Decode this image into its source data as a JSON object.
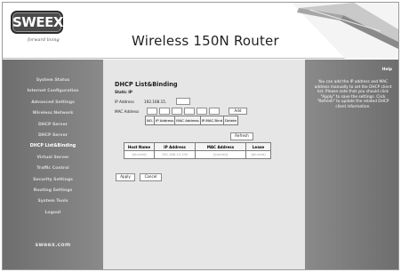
{
  "brand": {
    "logo_text": "SWEEX",
    "tagline": "forward living"
  },
  "header": {
    "title": "Wireless 150N Router"
  },
  "sidebar": {
    "items": [
      {
        "label": "System Status"
      },
      {
        "label": "Internet Configuration"
      },
      {
        "label": "Advanced Settings"
      },
      {
        "label": "Wireless Network"
      },
      {
        "label": "DHCP Server"
      },
      {
        "label": "DHCP Server"
      },
      {
        "label": "DHCP List&Binding",
        "active": true
      },
      {
        "label": "Virtual Server"
      },
      {
        "label": "Traffic Control"
      },
      {
        "label": "Security Settings"
      },
      {
        "label": "Routing Settings"
      },
      {
        "label": "System Tools"
      },
      {
        "label": "Logout"
      }
    ],
    "footer": "sweex.com"
  },
  "main": {
    "title": "DHCP List&Binding",
    "static_ip_label": "Static IP",
    "ip_address_label": "IP Address",
    "ip_prefix": "192.168.15.",
    "ip_value": "",
    "mac_address_label": "MAC Address",
    "mac_values": [
      "",
      "",
      "",
      "",
      "",
      ""
    ],
    "add_label": "Add",
    "binding_columns": [
      "NO.",
      "IP Address",
      "MAC Address",
      "IP-MAC Bind",
      "Delete"
    ],
    "refresh_label": "Refresh",
    "lease_table": {
      "columns": [
        "Host Name",
        "IP Address",
        "MAC Address",
        "Lease"
      ],
      "rows": [
        {
          "host": "[blurred]",
          "ip": "192.168.15.100",
          "mac": "[blurred]",
          "lease": "[blurred]"
        }
      ]
    },
    "apply_label": "Apply",
    "cancel_label": "Cancel"
  },
  "help": {
    "title": "Help",
    "text": "You can add the IP address and MAC address manually to set the DHCP client list. Please note that you should click \"Apply\" to save the settings. Click \"Refresh\" to update the related DHCP client information."
  },
  "colors": {
    "sidebar_bg": "#7d7d7d",
    "content_bg": "#e6e6e6",
    "logo_bg": "#4a4a4a"
  }
}
